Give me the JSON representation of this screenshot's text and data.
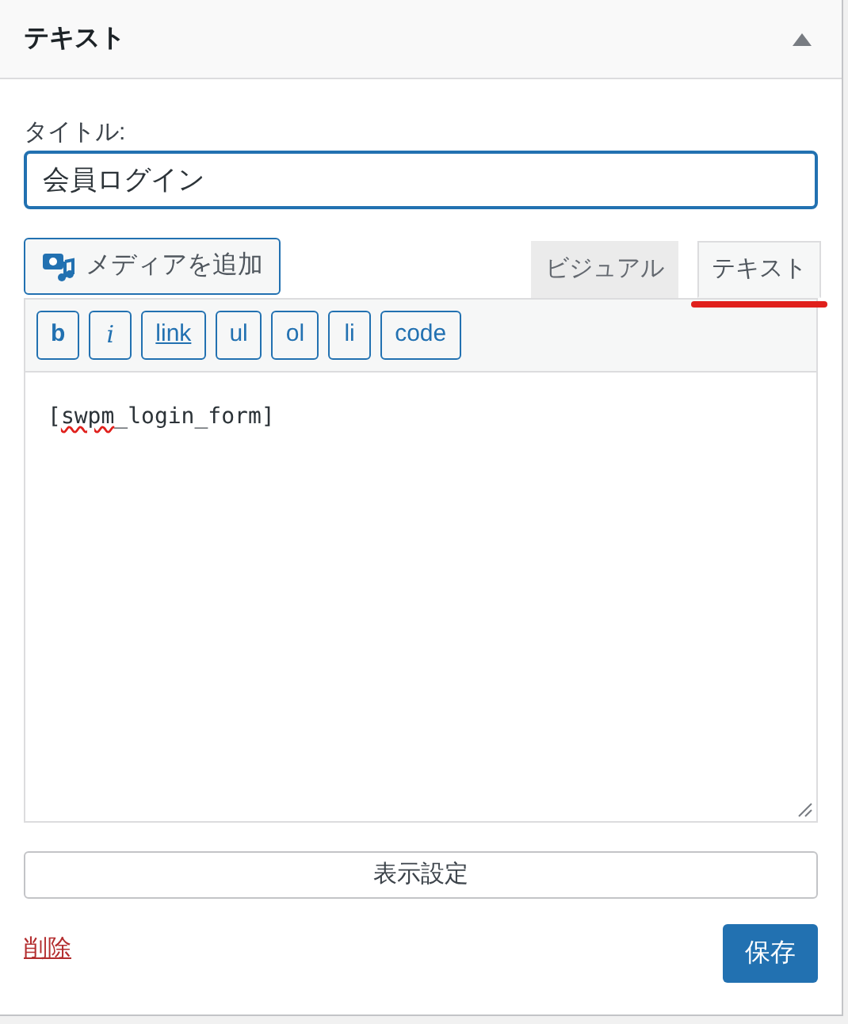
{
  "panel": {
    "title": "テキスト",
    "expanded": true
  },
  "title_field": {
    "label": "タイトル:",
    "value": "会員ログイン"
  },
  "media_button": "メディアを追加",
  "tabs": [
    {
      "label": "ビジュアル",
      "selected": false
    },
    {
      "label": "テキスト",
      "selected": true
    }
  ],
  "quicktags": [
    {
      "label": "b",
      "kind": "bold"
    },
    {
      "label": "i",
      "kind": "italic"
    },
    {
      "label": "link",
      "kind": "link"
    },
    {
      "label": "ul",
      "kind": "plain"
    },
    {
      "label": "ol",
      "kind": "plain"
    },
    {
      "label": "li",
      "kind": "plain"
    },
    {
      "label": "code",
      "kind": "plain"
    }
  ],
  "editor": {
    "prefix": "[",
    "misspelled": "swpm",
    "rest": "_login_form]"
  },
  "display_settings_button": "表示設定",
  "delete_link": "削除",
  "save_button": "保存"
}
